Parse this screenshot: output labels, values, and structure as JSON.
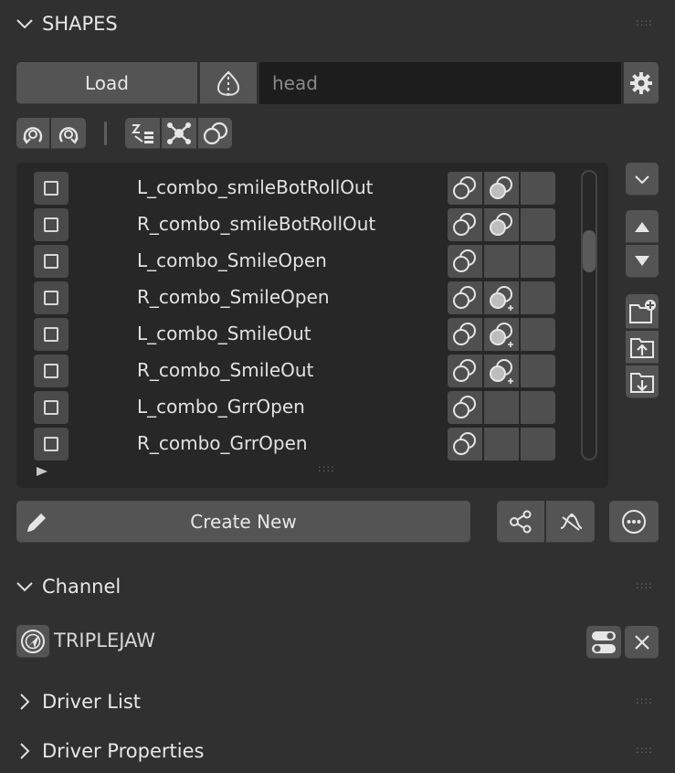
{
  "shapes_panel": {
    "title": "SHAPES",
    "load_label": "Load",
    "mesh_field_value": "head",
    "create_new_label": "Create New",
    "shape_list": [
      {
        "name": "L_combo_smileBotRollOut",
        "cells": [
          "combo-icon",
          "combo-filled-icon",
          ""
        ]
      },
      {
        "name": "R_combo_smileBotRollOut",
        "cells": [
          "combo-icon",
          "combo-filled-icon",
          ""
        ]
      },
      {
        "name": "L_combo_SmileOpen",
        "cells": [
          "combo-icon",
          "",
          ""
        ]
      },
      {
        "name": "R_combo_SmileOpen",
        "cells": [
          "combo-icon",
          "combo-add-icon",
          ""
        ]
      },
      {
        "name": "L_combo_SmileOut",
        "cells": [
          "combo-icon",
          "combo-add-icon",
          ""
        ]
      },
      {
        "name": "R_combo_SmileOut",
        "cells": [
          "combo-icon",
          "combo-add-icon",
          ""
        ]
      },
      {
        "name": "L_combo_GrrOpen",
        "cells": [
          "combo-icon",
          "",
          ""
        ]
      },
      {
        "name": "R_combo_GrrOpen",
        "cells": [
          "combo-icon",
          "",
          ""
        ]
      }
    ]
  },
  "channel_panel": {
    "title": "Channel",
    "channel_name": "TRIPLEJAW"
  },
  "driver_list_panel": {
    "title": "Driver List"
  },
  "driver_properties_panel": {
    "title": "Driver Properties"
  },
  "colors": {
    "background": "#303030",
    "button": "#545454",
    "field": "#1d1d1d",
    "list_bg": "#272727"
  }
}
